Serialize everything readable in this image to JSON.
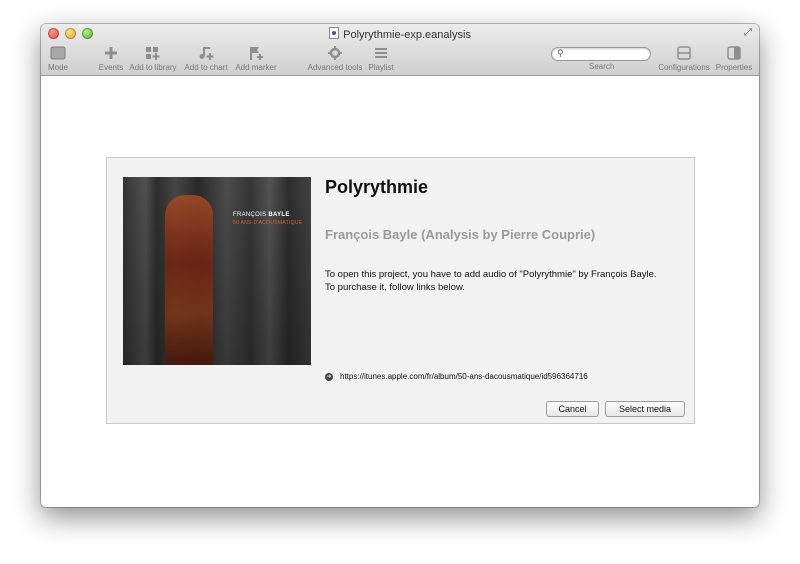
{
  "window": {
    "title": "Polyrythmie-exp.eanalysis"
  },
  "toolbar": {
    "mode": "Mode",
    "events": "Events",
    "add_to_library": "Add to library",
    "add_to_chart": "Add to chart",
    "add_marker": "Add marker",
    "advanced_tools": "Advanced tools",
    "playlist": "Playlist",
    "search_label": "Search",
    "search_placeholder": "",
    "configurations": "Configurations",
    "properties": "Properties"
  },
  "dialog": {
    "cover_artist_first": "FRANÇOIS",
    "cover_artist_last": "BAYLE",
    "cover_subtitle": "50 ANS D'ACOUSMATIQUE",
    "title": "Polyrythmie",
    "subtitle": "François Bayle (Analysis by Pierre Couprie)",
    "message_line1": "To open this project, you have to add audio of \"Polyrythmie\" by François Bayle.",
    "message_line2": "To purchase it, follow links below.",
    "link": "https://itunes.apple.com/fr/album/50-ans-dacousmatique/id596364716",
    "cancel_label": "Cancel",
    "select_label": "Select media"
  }
}
